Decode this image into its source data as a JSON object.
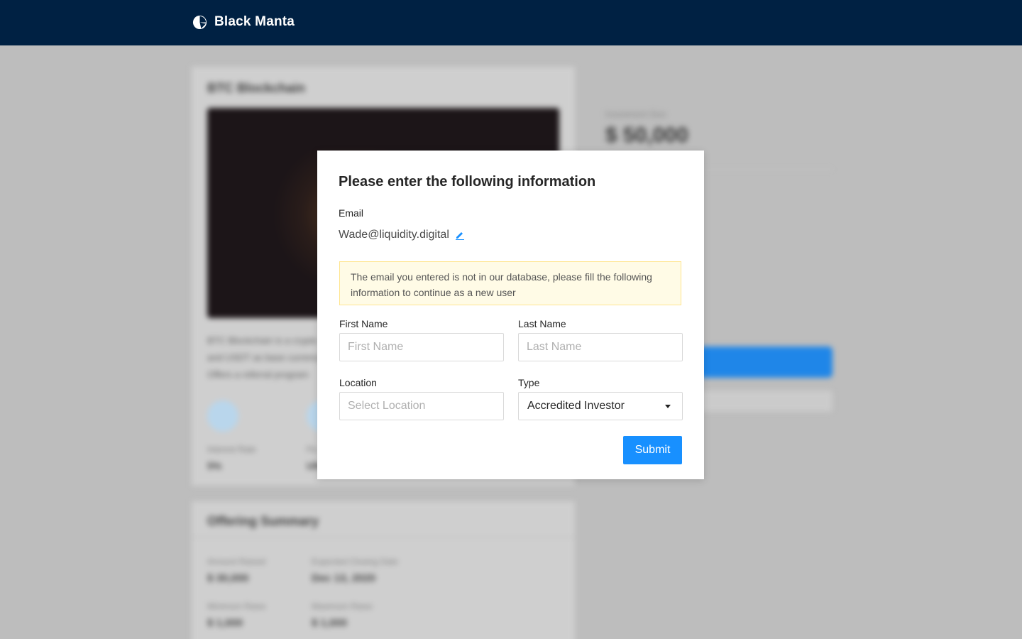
{
  "header": {
    "brand_name": "Black Manta",
    "logo_icon": "black-manta-logo-icon",
    "background_color": "#002143"
  },
  "background_page": {
    "offering_title": "BTC Blockchain",
    "description_lines": [
      "BTC Blockchain is a crypto",
      "and USDT as base currency",
      "Offers a referral program"
    ],
    "stats": [
      {
        "label": "Interest Rate",
        "value": "5%"
      },
      {
        "label": "Pa",
        "value": "UN"
      }
    ],
    "summary_title": "Offering Summary",
    "summary_items": [
      {
        "label": "Amount Raised",
        "value": "$ 30,000"
      },
      {
        "label": "Expected Closing Date",
        "value": "Dec 13, 2020"
      },
      {
        "label": "Minimum Raise",
        "value": "$ 1,000"
      },
      {
        "label": "Maximum Raise",
        "value": "$ 1,000"
      }
    ],
    "side_label": "Investment Size",
    "side_amount": "$ 50,000"
  },
  "modal": {
    "title": "Please enter the following information",
    "email_label": "Email",
    "email_value": "Wade@liquidity.digital",
    "edit_icon": "pencil-edit-icon",
    "notice_text": "The email you entered is not in our database, please fill the following information to continue as a new user",
    "first_name_label": "First Name",
    "first_name_placeholder": "First Name",
    "last_name_label": "Last Name",
    "last_name_placeholder": "Last Name",
    "location_label": "Location",
    "location_placeholder": "Select Location",
    "type_label": "Type",
    "type_value": "Accredited Investor",
    "submit_label": "Submit",
    "accent_color": "#1890ff",
    "notice_bg_color": "#fffbe6"
  }
}
